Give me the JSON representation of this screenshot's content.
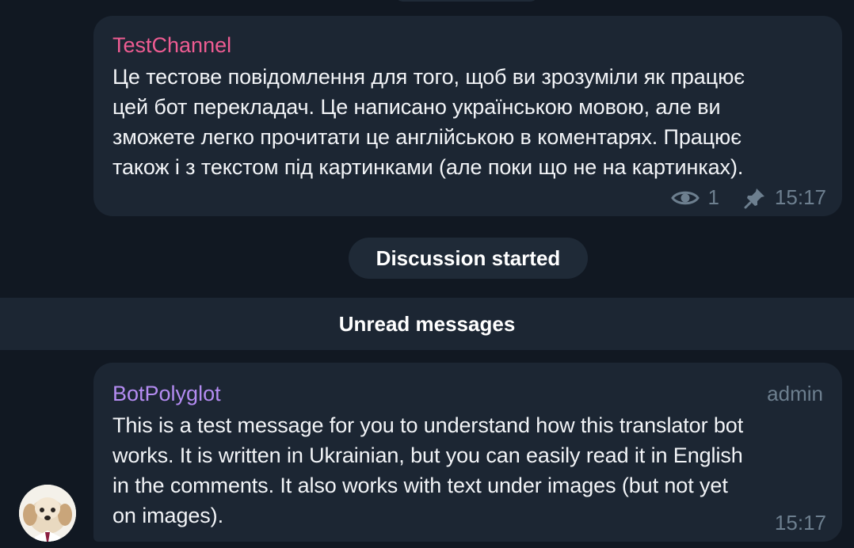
{
  "channel_post": {
    "sender": "TestChannel",
    "text": "Це тестове повідомлення для того, щоб ви зрозуміли як працює\nцей бот перекладач. Це написано українською мовою, але ви\nзможете легко прочитати це англійською в коментарях. Працює\nтакож і з текстом під картинками (але поки що не на картинках).",
    "views": "1",
    "time": "15:17",
    "icons": [
      "eye-icon",
      "pin-icon"
    ]
  },
  "service_message": "Discussion started",
  "unread_separator": "Unread messages",
  "reply_post": {
    "sender": "BotPolyglot",
    "role": "admin",
    "text": "This is a test message for you to understand how this translator bot\nworks. It is written in Ukrainian, but you can easily read it in English\nin the comments. It also works with text under images (but not yet\non images).",
    "time": "15:17",
    "avatar": "puppy-avatar"
  },
  "colors": {
    "background": "#111822",
    "bubble": "#1c2633",
    "channel_name": "#ee5c92",
    "bot_name": "#b48cf2",
    "meta": "#6d7f8f"
  }
}
